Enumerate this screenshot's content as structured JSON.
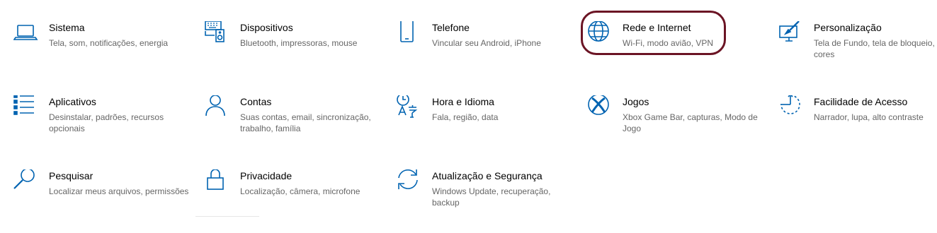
{
  "accent_color": "#0063b1",
  "highlight_color": "#6b1424",
  "tiles": [
    {
      "title": "Sistema",
      "desc": "Tela, som, notificações, energia",
      "icon": "laptop-icon"
    },
    {
      "title": "Dispositivos",
      "desc": "Bluetooth, impressoras, mouse",
      "icon": "keyboard-speaker-icon"
    },
    {
      "title": "Telefone",
      "desc": "Vincular seu Android, iPhone",
      "icon": "phone-icon"
    },
    {
      "title": "Rede e Internet",
      "desc": "Wi-Fi, modo avião, VPN",
      "icon": "globe-icon"
    },
    {
      "title": "Personalização",
      "desc": "Tela de Fundo, tela de bloqueio, cores",
      "icon": "paint-brush-icon"
    },
    {
      "title": "Aplicativos",
      "desc": "Desinstalar, padrões, recursos opcionais",
      "icon": "apps-list-icon"
    },
    {
      "title": "Contas",
      "desc": "Suas contas, email, sincronização, trabalho, família",
      "icon": "person-icon"
    },
    {
      "title": "Hora e Idioma",
      "desc": "Fala, região, data",
      "icon": "time-language-icon"
    },
    {
      "title": "Jogos",
      "desc": "Xbox Game Bar, capturas, Modo de Jogo",
      "icon": "xbox-icon"
    },
    {
      "title": "Facilidade de Acesso",
      "desc": "Narrador, lupa, alto contraste",
      "icon": "ease-of-access-icon"
    },
    {
      "title": "Pesquisar",
      "desc": "Localizar meus arquivos, permissões",
      "icon": "search-icon"
    },
    {
      "title": "Privacidade",
      "desc": "Localização, câmera, microfone",
      "icon": "lock-icon"
    },
    {
      "title": "Atualização e Segurança",
      "desc": "Windows Update, recuperação, backup",
      "icon": "sync-icon"
    }
  ]
}
